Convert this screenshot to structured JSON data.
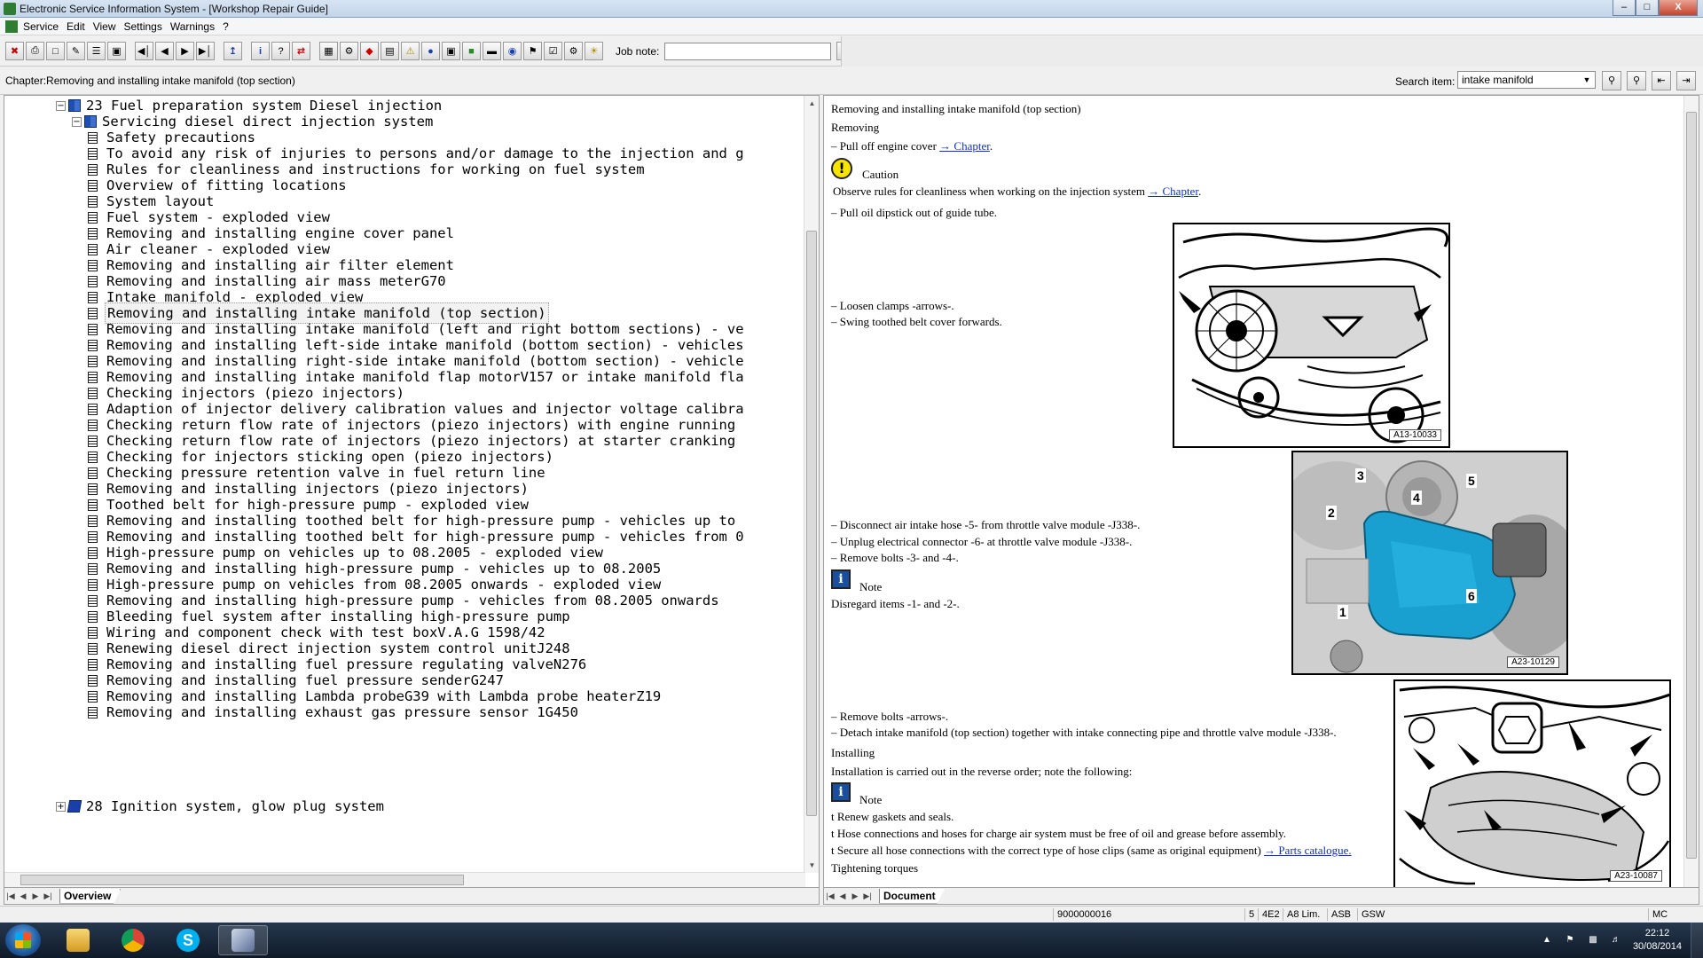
{
  "window": {
    "title": "Electronic Service Information System - [Workshop Repair Guide]",
    "minimize": "–",
    "maximize": "□",
    "close": "X"
  },
  "menu": {
    "items": [
      "Service",
      "Edit",
      "View",
      "Settings",
      "Warnings",
      "?"
    ]
  },
  "toolbar": {
    "job_note_label": "Job note:",
    "job_note_value": ""
  },
  "chapter_bar": {
    "chapter": "Chapter:Removing and installing intake manifold (top section)",
    "search_label": "Search item:",
    "search_value": "intake manifold"
  },
  "tree": {
    "parent": "23 Fuel preparation system Diesel injection",
    "child": "Servicing diesel direct injection system",
    "items": [
      "Safety precautions",
      "To avoid any risk of injuries to persons and/or damage to the injection and g",
      "Rules for cleanliness and instructions for working on fuel system",
      "Overview of fitting locations",
      "System layout",
      "Fuel system - exploded view",
      "Removing and installing engine cover panel",
      "Air cleaner - exploded view",
      "Removing and installing air filter element",
      "Removing and installing air mass meterG70",
      "Intake manifold - exploded view",
      "Removing and installing intake manifold (top section)",
      "Removing and installing intake manifold (left and right bottom sections) - ve",
      "Removing and installing left-side intake manifold (bottom section) - vehicles",
      "Removing and installing right-side intake manifold (bottom section) - vehicle",
      "Removing and installing intake manifold flap motorV157 or intake manifold fla",
      "Checking injectors (piezo injectors)",
      "Adaption of injector delivery calibration values and injector voltage calibra",
      "Checking return flow rate of injectors (piezo injectors) with engine running",
      "Checking return flow rate of injectors (piezo injectors) at starter cranking",
      "Checking for injectors sticking open (piezo injectors)",
      "Checking pressure retention valve in fuel return line",
      "Removing and installing injectors (piezo injectors)",
      "Toothed belt for high-pressure pump - exploded view",
      "Removing and installing toothed belt for high-pressure pump - vehicles up to",
      "Removing and installing toothed belt for high-pressure pump - vehicles from 0",
      "High-pressure pump on vehicles up to 08.2005 - exploded view",
      "Removing and installing high-pressure pump - vehicles up to 08.2005",
      "High-pressure pump on vehicles from 08.2005 onwards - exploded view",
      "Removing and installing high-pressure pump - vehicles from 08.2005 onwards",
      "Bleeding fuel system after installing high-pressure pump",
      "Wiring and component check with test boxV.A.G 1598/42",
      "Renewing diesel direct injection system control unitJ248",
      "Removing and installing fuel pressure regulating valveN276",
      "Removing and installing fuel pressure senderG247",
      "Removing and installing Lambda probeG39 with Lambda probe heaterZ19",
      "Removing and installing exhaust gas pressure sensor 1G450"
    ],
    "next_group": "28 Ignition system, glow plug system",
    "tab": "Overview"
  },
  "document": {
    "title": "Removing and installing intake manifold (top section)",
    "removing": "Removing",
    "step_cover": "–  Pull off engine cover",
    "link_chapter": "→ Chapter",
    "caution": "Caution",
    "caution_text": "Observe rules for cleanliness when working on the injection system",
    "step_dipstick": "–  Pull oil dipstick out of guide tube.",
    "step_clamps": "–  Loosen clamps -arrows-.",
    "step_swing": "–  Swing toothed belt cover forwards.",
    "fig1_label": "A13-10033",
    "step_hose": "–  Disconnect air intake hose -5- from throttle valve module -J338-.",
    "step_connector": "–  Unplug electrical connector -6- at throttle valve module -J338-.",
    "step_bolts34": "–  Remove bolts -3- and -4-.",
    "note": "Note",
    "note_text": "Disregard items -1- and -2-.",
    "fig2_label": "A23-10129",
    "fig2_callouts": [
      "1",
      "2",
      "3",
      "4",
      "5",
      "6"
    ],
    "step_bolts_arrows": "–  Remove bolts -arrows-.",
    "step_detach": "–  Detach intake manifold (top section) together with intake connecting pipe and throttle valve module -J338-.",
    "installing": "Installing",
    "install_text": "Installation is carried out in the reverse order; note the following:",
    "note2": "Note",
    "bullet_gaskets": "t  Renew gaskets and seals.",
    "bullet_hoses": "t  Hose connections and hoses for charge air system must be free of oil and grease before assembly.",
    "bullet_clips": "t  Secure all hose connections with the correct type of hose clips (same as original equipment)",
    "link_parts": "→ Parts catalogue.",
    "torques": "Tightening torques",
    "fig3_label": "A23-10087",
    "tab": "Document"
  },
  "statusbar": {
    "code": "9000000016",
    "c1": "5",
    "c2": "4E2",
    "c3": "A8 Lim.",
    "c4": "ASB",
    "c5": "GSW",
    "c6": "MC"
  },
  "taskbar": {
    "time": "22:12",
    "date": "30/08/2014"
  },
  "colors": {
    "accent_blue": "#1a3fa8",
    "intake_highlight": "#1aa0d0",
    "caution_yellow": "#f7e400"
  }
}
